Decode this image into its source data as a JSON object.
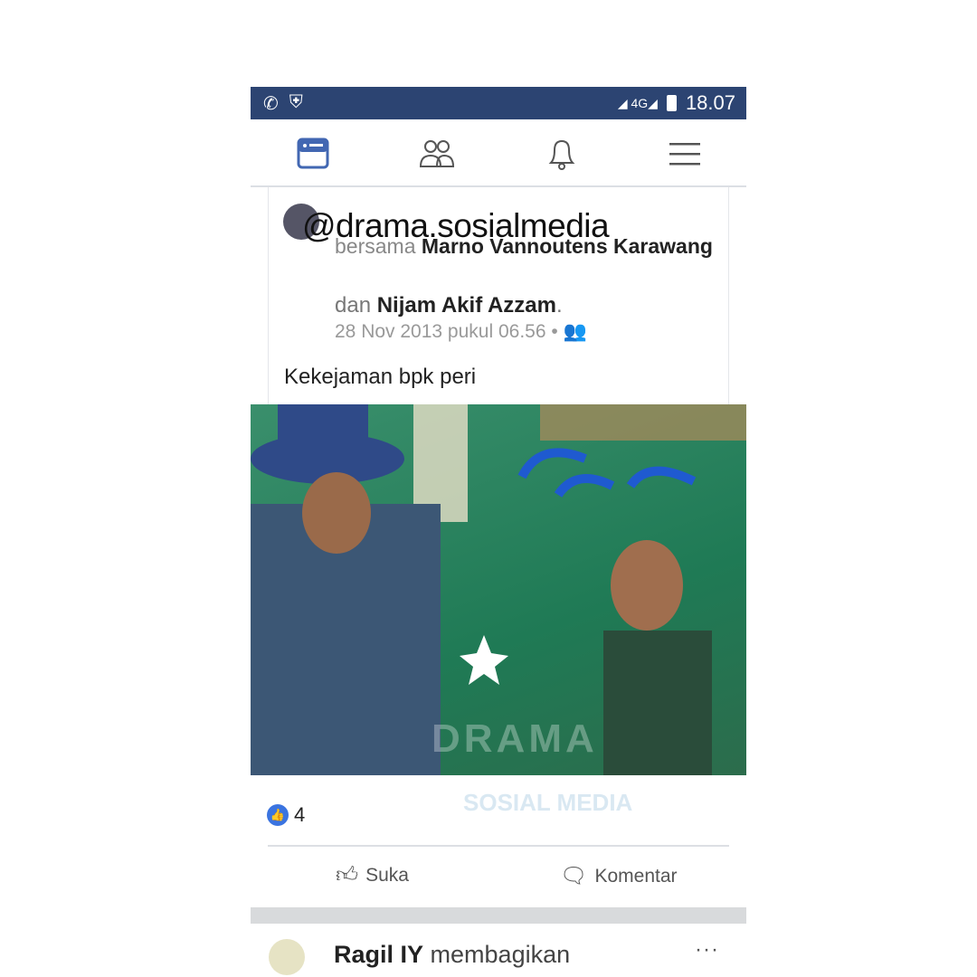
{
  "status_bar": {
    "time": "18.07",
    "network": "4G",
    "icons": [
      "whatsapp-icon",
      "shield-icon",
      "signal-icon",
      "battery-icon"
    ]
  },
  "nav": {
    "items": [
      "news-feed-icon",
      "friends-icon",
      "notifications-icon",
      "menu-icon"
    ],
    "accent": "#4267b2"
  },
  "watermark": "@drama.sosialmedia",
  "post": {
    "with_prefix": "bersama",
    "tagged_1": "Marno Vannoutens Karawang",
    "conj": "dan",
    "tagged_2": "Nijam Akif Azzam",
    "timestamp": "28 Nov 2013 pukul 06.56",
    "privacy": "friends-icon",
    "text": "Kekejaman bpk peri",
    "like_count": "4",
    "like_label": "Suka",
    "comment_label": "Komentar"
  },
  "next_post": {
    "name": "Ragil IY",
    "action": "membagikan",
    "more": "···"
  },
  "photo_watermark": {
    "line1": "DRAMA",
    "line2": "SOSIAL MEDIA"
  }
}
